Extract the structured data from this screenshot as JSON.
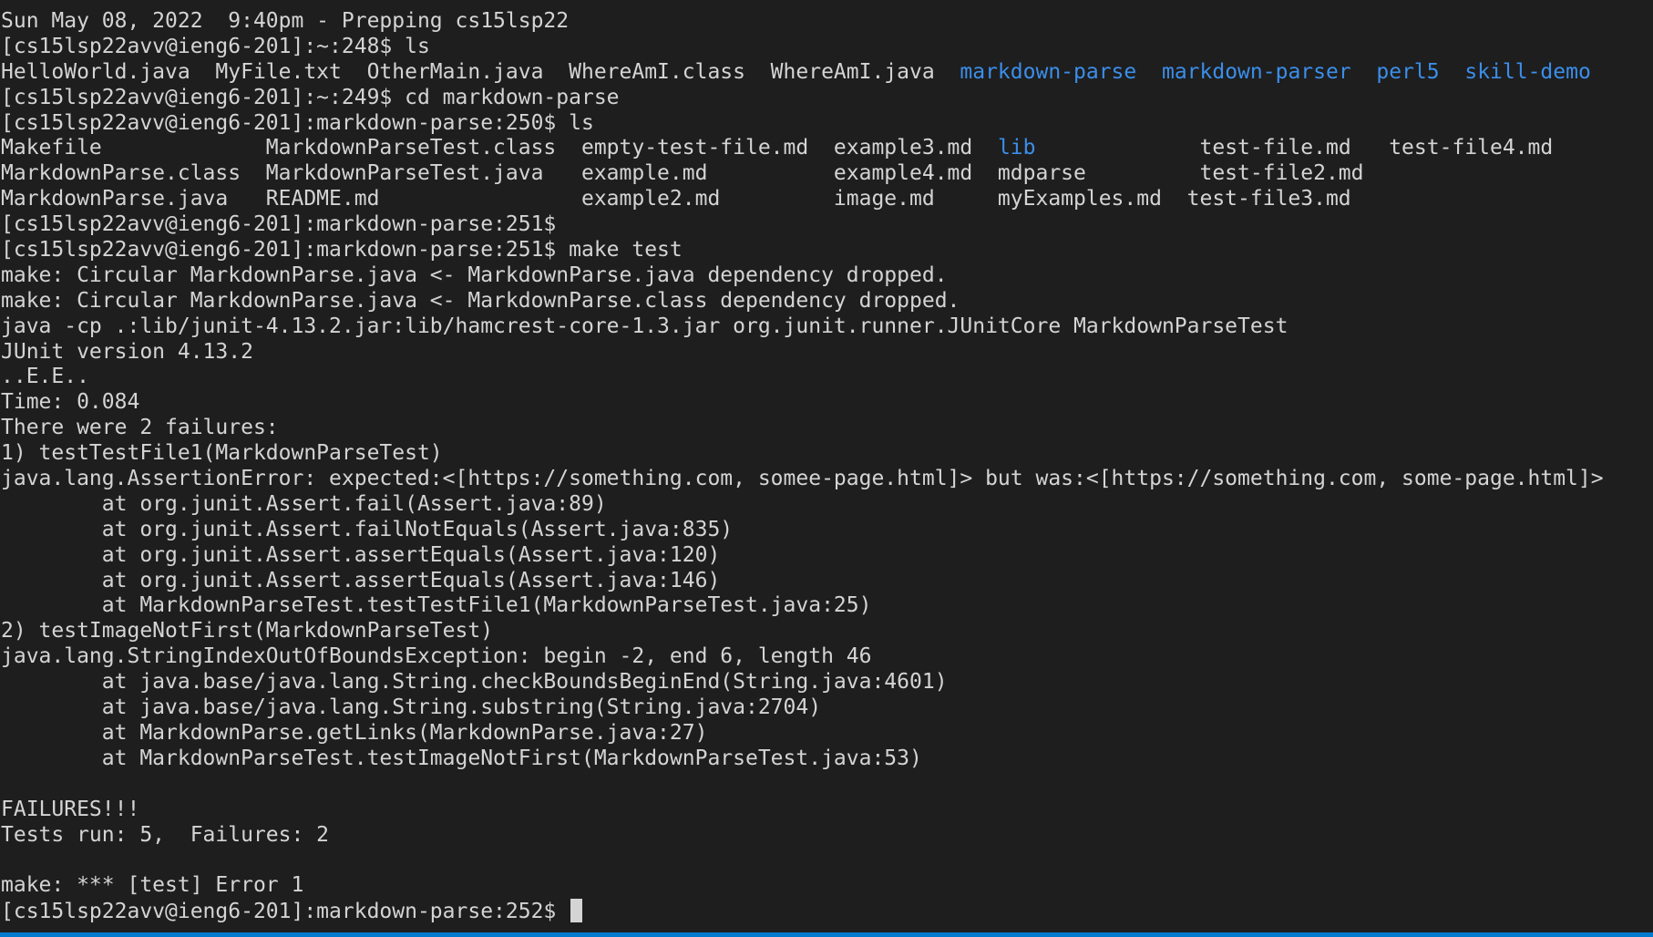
{
  "terminal": {
    "lines": [
      {
        "text": "Sun May 08, 2022  9:40pm - Prepping cs15lsp22"
      },
      {
        "text": "[cs15lsp22avv@ieng6-201]:~:248$ ls"
      },
      {
        "segments": [
          {
            "text": "HelloWorld.java  MyFile.txt  OtherMain.java  WhereAmI.class  WhereAmI.java  ",
            "dir": false
          },
          {
            "text": "markdown-parse",
            "dir": true
          },
          {
            "text": "  ",
            "dir": false
          },
          {
            "text": "markdown-parser",
            "dir": true
          },
          {
            "text": "  ",
            "dir": false
          },
          {
            "text": "perl5",
            "dir": true
          },
          {
            "text": "  ",
            "dir": false
          },
          {
            "text": "skill-demo",
            "dir": true
          }
        ]
      },
      {
        "text": "[cs15lsp22avv@ieng6-201]:~:249$ cd markdown-parse"
      },
      {
        "text": "[cs15lsp22avv@ieng6-201]:markdown-parse:250$ ls"
      },
      {
        "segments": [
          {
            "text": "Makefile             MarkdownParseTest.class  empty-test-file.md  example3.md  ",
            "dir": false
          },
          {
            "text": "lib",
            "dir": true
          },
          {
            "text": "             test-file.md   test-file4.md",
            "dir": false
          }
        ]
      },
      {
        "text": "MarkdownParse.class  MarkdownParseTest.java   example.md          example4.md  mdparse         test-file2.md"
      },
      {
        "text": "MarkdownParse.java   README.md                example2.md         image.md     myExamples.md  test-file3.md"
      },
      {
        "text": "[cs15lsp22avv@ieng6-201]:markdown-parse:251$"
      },
      {
        "text": "[cs15lsp22avv@ieng6-201]:markdown-parse:251$ make test"
      },
      {
        "text": "make: Circular MarkdownParse.java <- MarkdownParse.java dependency dropped."
      },
      {
        "text": "make: Circular MarkdownParse.java <- MarkdownParse.class dependency dropped."
      },
      {
        "text": "java -cp .:lib/junit-4.13.2.jar:lib/hamcrest-core-1.3.jar org.junit.runner.JUnitCore MarkdownParseTest"
      },
      {
        "text": "JUnit version 4.13.2"
      },
      {
        "text": "..E.E.."
      },
      {
        "text": "Time: 0.084"
      },
      {
        "text": "There were 2 failures:"
      },
      {
        "text": "1) testTestFile1(MarkdownParseTest)"
      },
      {
        "text": "java.lang.AssertionError: expected:<[https://something.com, somee-page.html]> but was:<[https://something.com, some-page.html]>"
      },
      {
        "text": "        at org.junit.Assert.fail(Assert.java:89)"
      },
      {
        "text": "        at org.junit.Assert.failNotEquals(Assert.java:835)"
      },
      {
        "text": "        at org.junit.Assert.assertEquals(Assert.java:120)"
      },
      {
        "text": "        at org.junit.Assert.assertEquals(Assert.java:146)"
      },
      {
        "text": "        at MarkdownParseTest.testTestFile1(MarkdownParseTest.java:25)"
      },
      {
        "text": "2) testImageNotFirst(MarkdownParseTest)"
      },
      {
        "text": "java.lang.StringIndexOutOfBoundsException: begin -2, end 6, length 46"
      },
      {
        "text": "        at java.base/java.lang.String.checkBoundsBeginEnd(String.java:4601)"
      },
      {
        "text": "        at java.base/java.lang.String.substring(String.java:2704)"
      },
      {
        "text": "        at MarkdownParse.getLinks(MarkdownParse.java:27)"
      },
      {
        "text": "        at MarkdownParseTest.testImageNotFirst(MarkdownParseTest.java:53)"
      },
      {
        "text": ""
      },
      {
        "text": "FAILURES!!!"
      },
      {
        "text": "Tests run: 5,  Failures: 2"
      },
      {
        "text": ""
      },
      {
        "text": "make: *** [test] Error 1"
      },
      {
        "text": "[cs15lsp22avv@ieng6-201]:markdown-parse:252$ ",
        "cursor": true
      }
    ]
  },
  "colors": {
    "background": "#1e1e1e",
    "foreground": "#d4d4d4",
    "directory": "#3b8eea",
    "status_bar": "#007acc"
  }
}
